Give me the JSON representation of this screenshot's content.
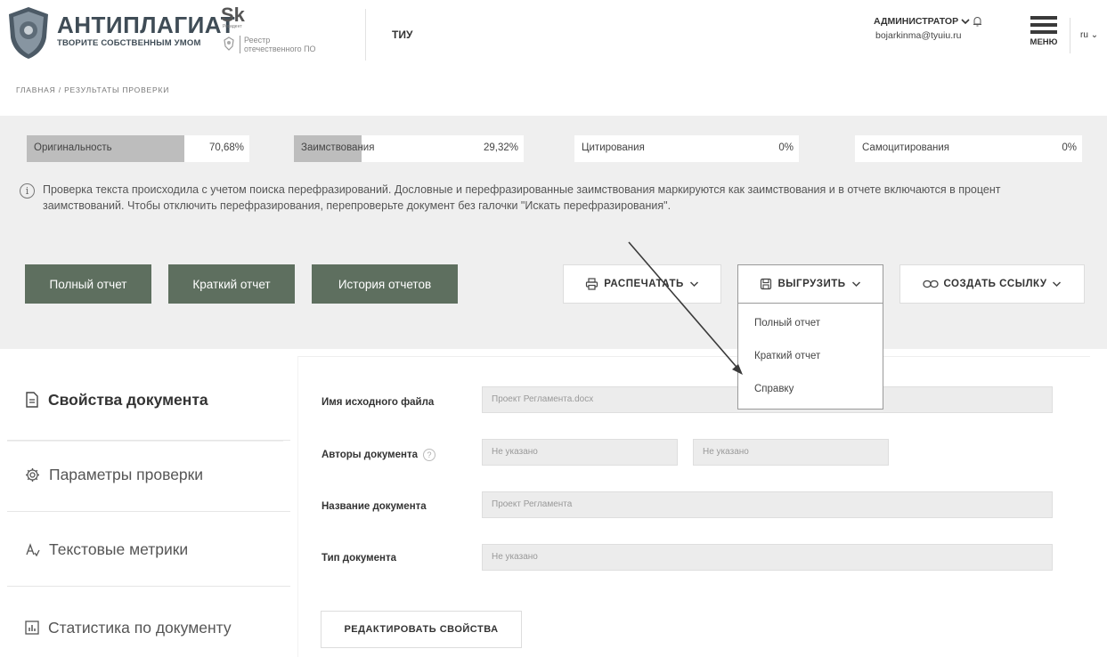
{
  "header": {
    "brand_name": "АНТИПЛАГИАТ",
    "brand_slogan": "ТВОРИТЕ СОБСТВЕННЫМ УМОМ",
    "sk_logo": "Sk",
    "sk_sub": "Резидент",
    "registry_line1": "Реестр",
    "registry_line2": "отечественного ПО",
    "organization": "ТИУ",
    "user_role": "АДМИНИСТРАТОР",
    "user_email": "bojarkinma@tyuiu.ru",
    "menu_label": "МЕНЮ",
    "language": "ru"
  },
  "breadcrumb": "ГЛАВНАЯ / РЕЗУЛЬТАТЫ ПРОВЕРКИ",
  "metrics": [
    {
      "label": "Оригинальность",
      "value": "70,68%",
      "fill": 0.7068
    },
    {
      "label": "Заимствования",
      "value": "29,32%",
      "fill": 0.2932
    },
    {
      "label": "Цитирования",
      "value": "0%",
      "fill": 0
    },
    {
      "label": "Самоцитирования",
      "value": "0%",
      "fill": 0
    }
  ],
  "info_text": "Проверка текста происходила с учетом поиска перефразирований. Дословные и перефразированные заимствования маркируются как заимствования и в отчете включаются в процент заимствований. Чтобы отключить перефразирования, перепроверьте документ без галочки \"Искать перефразирования\".",
  "actions": {
    "full_report": "Полный отчет",
    "short_report": "Краткий отчет",
    "report_history": "История отчетов",
    "print": "РАСПЕЧАТАТЬ",
    "export": "ВЫГРУЗИТЬ",
    "create_link": "СОЗДАТЬ ССЫЛКУ"
  },
  "export_menu": [
    "Полный отчет",
    "Краткий отчет",
    "Справку"
  ],
  "sidebar": {
    "items": [
      {
        "label": "Свойства документа",
        "icon": "document-icon"
      },
      {
        "label": "Параметры проверки",
        "icon": "gear-icon"
      },
      {
        "label": "Текстовые метрики",
        "icon": "text-metrics-icon"
      },
      {
        "label": "Статистика по документу",
        "icon": "statistics-icon"
      }
    ]
  },
  "form": {
    "source_file_label": "Имя исходного файла",
    "source_file_value": "Проект Регламента.docx",
    "authors_label": "Авторы документа",
    "authors_value_1": "Не указано",
    "authors_value_2": "Не указано",
    "doc_name_label": "Название документа",
    "doc_name_value": "Проект Регламента",
    "doc_type_label": "Тип документа",
    "doc_type_value": "Не указано",
    "edit_button": "РЕДАКТИРОВАТЬ СВОЙСТВА"
  },
  "colors": {
    "dark_button": "#5e6f5f",
    "metric_fill": "#bdbdbd",
    "panel": "#efefef"
  }
}
